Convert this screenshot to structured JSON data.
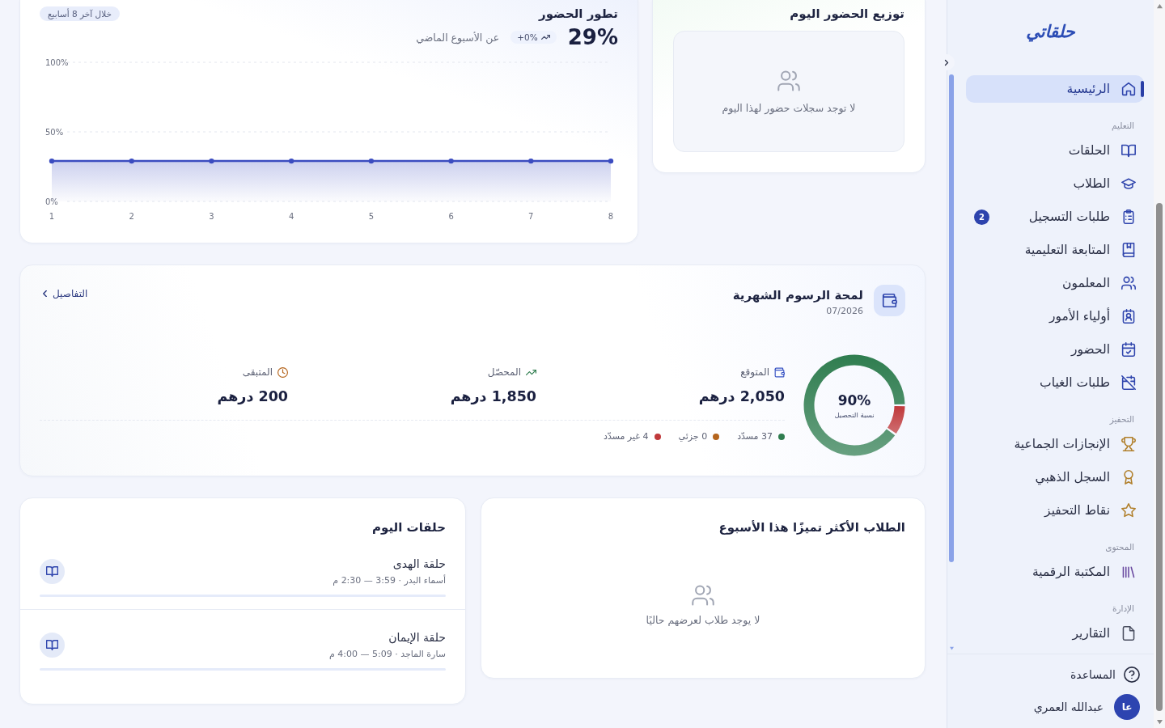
{
  "attendance_today": {
    "title": "توزيع الحضور اليوم",
    "empty_text": "لا توجد سجلات حضور لهذا اليوم"
  },
  "attendance_trend": {
    "title": "تطور الحضور",
    "period_badge": "خلال آخر 8 أسابيع",
    "rate": "29%",
    "change": "+0%",
    "change_caption": "عن الأسبوع الماضي",
    "chart_data": {
      "type": "area",
      "x": [
        1,
        2,
        3,
        4,
        5,
        6,
        7,
        8
      ],
      "series": [
        {
          "color": "#3b4cc0",
          "values": [
            29,
            29,
            29,
            29,
            29,
            29,
            29,
            29
          ]
        }
      ],
      "xlim": [
        1,
        8
      ],
      "ylim": [
        0,
        100
      ],
      "yticks": [
        {
          "value": 0,
          "label": "0%"
        },
        {
          "value": 50,
          "label": "50%"
        },
        {
          "value": 100,
          "label": "100%"
        }
      ],
      "xticks": [
        1,
        2,
        3,
        4,
        5,
        6,
        7,
        8
      ]
    }
  },
  "fees": {
    "title": "لمحة الرسوم الشهرية",
    "period": "07/2026",
    "details_link": "التفاصيل",
    "collection": {
      "value": "90%",
      "caption": "نسبة التحصيل"
    },
    "chart_data": {
      "type": "donut",
      "values": [
        90.2,
        0,
        9.8
      ]
    },
    "stats": [
      {
        "kind": "expected",
        "label": "المتوقع",
        "value": "2,050 درهم"
      },
      {
        "kind": "collected",
        "label": "المحصّل",
        "value": "1,850 درهم"
      },
      {
        "kind": "remaining",
        "label": "المتبقى",
        "value": "200 درهم"
      }
    ],
    "legend": [
      {
        "text": "37 مسدّد",
        "color": "#2f7d4f"
      },
      {
        "text": "0 جزئي",
        "color": "#b5651d"
      },
      {
        "text": "4 غير مسدّد",
        "color": "#c0393b"
      }
    ]
  },
  "top_students": {
    "title": "الطلاب الأكثر تميزًا هذا الأسبوع",
    "empty_text": "لا يوجد طلاب لعرضهم حاليًا"
  },
  "today_circles": {
    "title": "حلقات اليوم",
    "items": [
      {
        "name": "حلقة الهدى",
        "details": "أسماء البدر · 3:59 — 2:30 م"
      },
      {
        "name": "حلقة الإيمان",
        "details": "سارة الماجد · 5:09 — 4:00 م"
      }
    ]
  },
  "sidebar": {
    "logo": "حلقاتي",
    "sections": [
      {
        "items": [
          {
            "label": "الرئيسية",
            "kind": "home",
            "selected": true
          }
        ]
      },
      {
        "heading": "التعليم",
        "items": [
          {
            "label": "الحلقات",
            "kind": "book",
            "selected": false
          },
          {
            "label": "الطلاب",
            "kind": "cap",
            "selected": false
          },
          {
            "label": "طلبات التسجيل",
            "kind": "clipboard",
            "selected": false,
            "badge": "2"
          },
          {
            "label": "المتابعة التعليمية",
            "kind": "journal",
            "selected": false
          },
          {
            "label": "المعلمون",
            "kind": "people",
            "selected": false
          },
          {
            "label": "أولياء الأمور",
            "kind": "guardian",
            "selected": false
          },
          {
            "label": "الحضور",
            "kind": "calendar",
            "selected": false
          },
          {
            "label": "طلبات الغياب",
            "kind": "absence",
            "selected": false
          }
        ]
      },
      {
        "heading": "التحفيز",
        "items": [
          {
            "label": "الإنجازات الجماعية",
            "kind": "trophy",
            "selected": false
          },
          {
            "label": "السجل الذهبي",
            "kind": "medal",
            "selected": false
          },
          {
            "label": "نقاط التحفيز",
            "kind": "star",
            "selected": false
          }
        ]
      },
      {
        "heading": "المحتوى",
        "items": [
          {
            "label": "المكتبة الرقمية",
            "kind": "library",
            "selected": false
          }
        ]
      },
      {
        "heading": "الإدارة",
        "items": [
          {
            "label": "التقارير",
            "kind": "file",
            "selected": false
          }
        ]
      }
    ],
    "help": "المساعدة",
    "user": {
      "initials": "عا",
      "name": "عبدالله العمري"
    }
  }
}
